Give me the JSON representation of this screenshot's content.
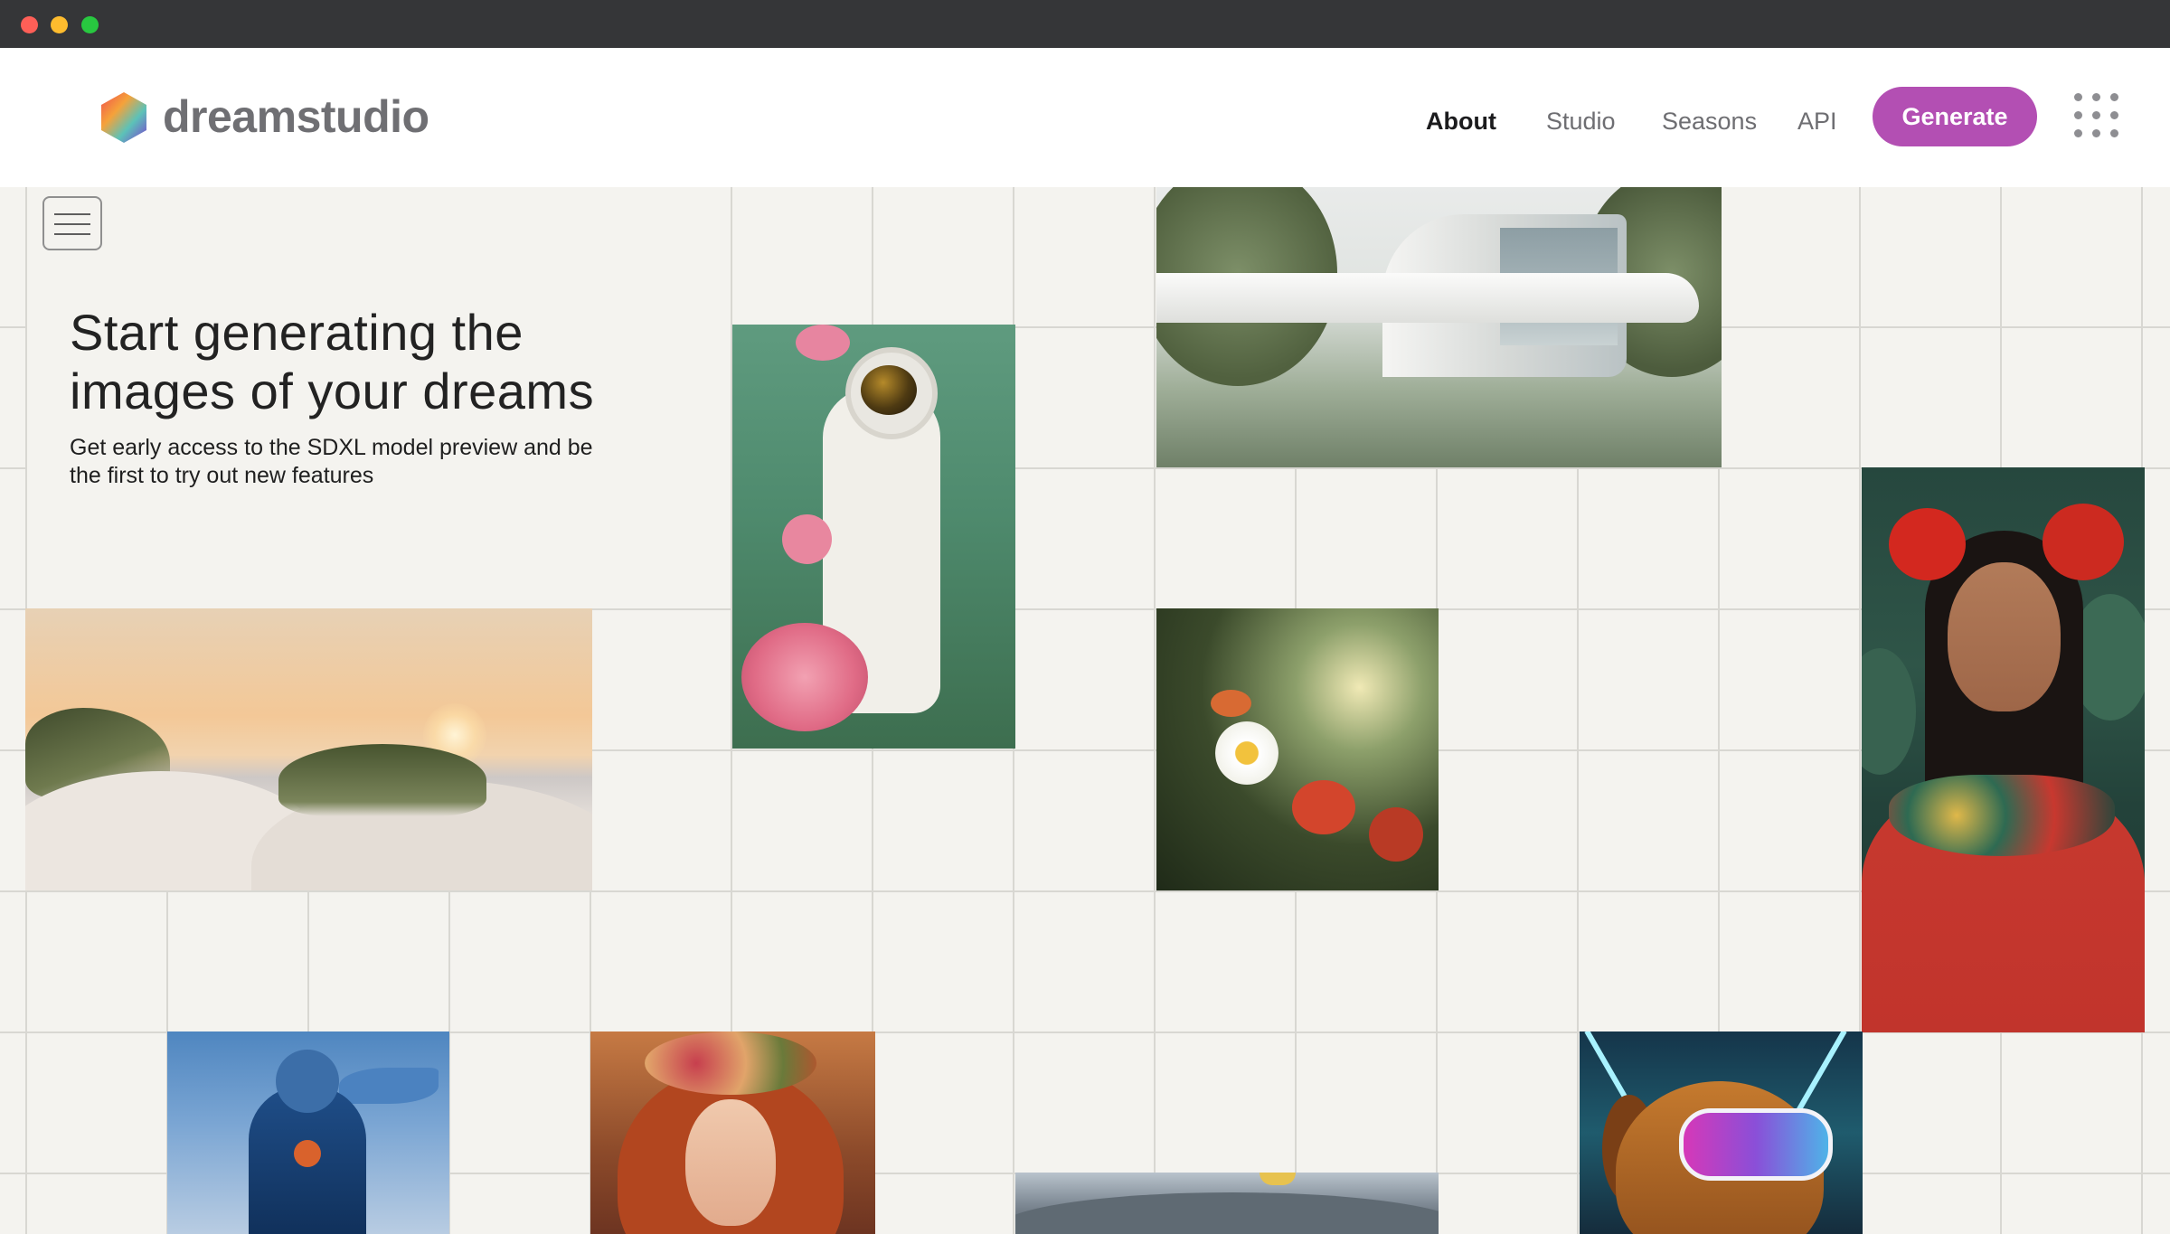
{
  "window": {
    "traffic_lights": [
      "close",
      "minimize",
      "zoom"
    ]
  },
  "header": {
    "logo_text": "dreamstudio",
    "nav": {
      "about": "About",
      "studio": "Studio",
      "seasons": "Seasons",
      "api": "API"
    },
    "active_nav": "About",
    "generate_label": "Generate",
    "apps_icon": "grid-dots-icon"
  },
  "hero": {
    "menu_icon": "hamburger-menu-icon",
    "title": "Start generating the images of your dreams",
    "subtitle": "Get early access to the SDXL model preview and be the first to try out new features"
  },
  "gallery": {
    "images": [
      "sunset-dunes-image",
      "astronaut-roses-image",
      "modern-house-image",
      "daisy-flowers-image",
      "frida-portrait-image",
      "robot-pilot-image",
      "flower-crown-woman-image",
      "mountain-landscape-image",
      "vr-dog-image"
    ]
  },
  "colors": {
    "accent": "#b34fb3",
    "titlebar": "#353638",
    "background": "#f4f3ef",
    "grid_line": "#d8d7d2"
  }
}
